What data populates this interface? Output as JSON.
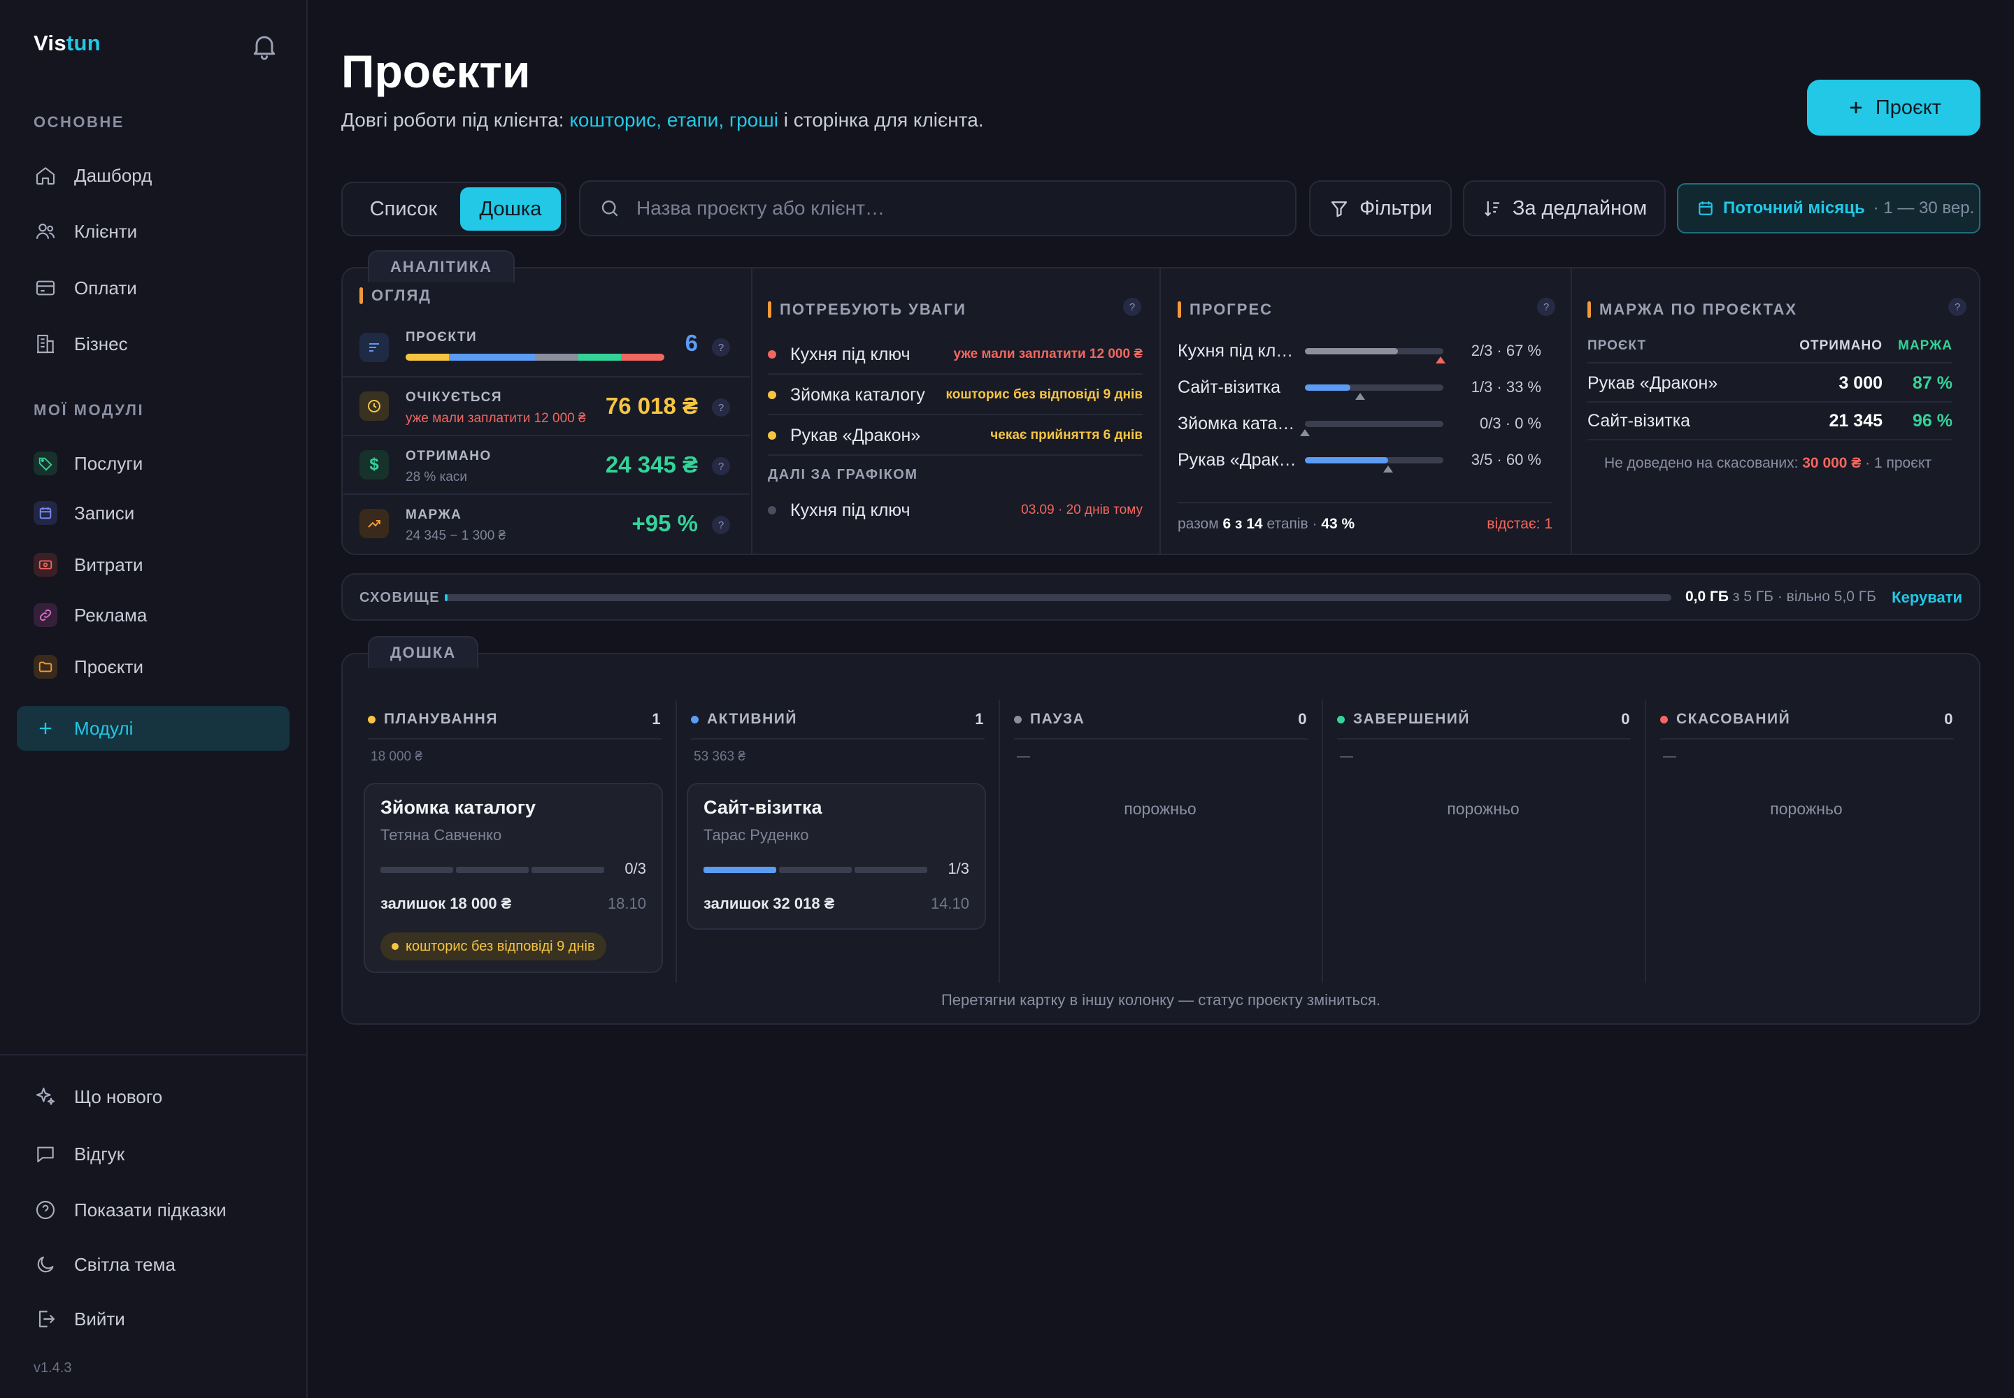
{
  "sidebar": {
    "logo_a": "Vis",
    "logo_b": "tun",
    "sec_main": "ОСНОВНЕ",
    "sec_modules": "МОЇ МОДУЛІ",
    "main_items": [
      "Дашборд",
      "Клієнти",
      "Оплати",
      "Бізнес"
    ],
    "module_items": [
      "Послуги",
      "Записи",
      "Витрати",
      "Реклама",
      "Проєкти"
    ],
    "modules_btn": "Модулі",
    "bottom_items": [
      "Що нового",
      "Відгук",
      "Показати підказки",
      "Світла тема",
      "Вийти"
    ],
    "version": "v1.4.3"
  },
  "header": {
    "title": "Проєкти",
    "sub_a": "Довгі роботи під клієнта: ",
    "sub_hl": "кошторис, етапи, гроші",
    "sub_b": " і сторінка для клієнта.",
    "new_btn": "Проєкт"
  },
  "toolbar": {
    "view_list": "Список",
    "view_board": "Дошка",
    "search_placeholder": "Назва проєкту або клієнт…",
    "filters": "Фільтри",
    "sort": "За дедлайном",
    "period": "Поточний місяць",
    "period_range": "· 1 — 30 вер."
  },
  "analytics": {
    "tag": "АНАЛІТИКА",
    "overview": {
      "title": "ОГЛЯД",
      "projects_label": "ПРОЄКТИ",
      "projects_val": "6",
      "expected_label": "ОЧІКУЄТЬСЯ",
      "expected_sub": "уже мали заплатити 12 000 ₴",
      "expected_val": "76 018 ₴",
      "received_label": "ОТРИМАНО",
      "received_sub": "28 % каси",
      "received_val": "24 345 ₴",
      "margin_label": "МАРЖА",
      "margin_sub": "24 345 − 1 300 ₴",
      "margin_val": "+95 %"
    },
    "attention": {
      "title": "ПОТРЕБУЮТЬ УВАГИ",
      "items": [
        {
          "name": "Кухня під ключ",
          "note": "уже мали заплатити 12 000 ₴",
          "color": "#f2675f"
        },
        {
          "name": "Зйомка каталогу",
          "note": "кошторис без відповіді 9 днів",
          "color": "#f5c542"
        },
        {
          "name": "Рукав «Дракон»",
          "note": "чекає прийняття 6 днів",
          "color": "#f5c542"
        }
      ],
      "next_title": "ДАЛІ ЗА ГРАФІКОМ",
      "next": {
        "name": "Кухня під ключ",
        "note": "03.09 · 20 днів тому"
      }
    },
    "progress": {
      "title": "ПРОГРЕС",
      "items": [
        {
          "name": "Кухня під ключ",
          "value": "2/3 · 67 %",
          "pct": 0.67,
          "color": "#8e909c",
          "mark": 0.98,
          "late": true
        },
        {
          "name": "Сайт-візитка",
          "value": "1/3 · 33 %",
          "pct": 0.33,
          "color": "#5b9cf5",
          "mark": 0.4,
          "late": false
        },
        {
          "name": "Зйомка каталогу",
          "value": "0/3 · 0 %",
          "pct": 0,
          "color": "#8e909c",
          "mark": 0,
          "late": false
        },
        {
          "name": "Рукав «Дракон»",
          "value": "3/5 · 60 %",
          "pct": 0.6,
          "color": "#5b9cf5",
          "mark": 0.6,
          "late": false
        }
      ],
      "total_a": "разом ",
      "total_b": "6 з 14",
      "total_c": " етапів · ",
      "total_d": "43 %",
      "behind": "відстає: 1"
    },
    "margin": {
      "title": "МАРЖА ПО ПРОЄКТАХ",
      "col_project": "ПРОЄКТ",
      "col_received": "ОТРИМАНО",
      "col_margin": "МАРЖА",
      "rows": [
        {
          "name": "Рукав «Дракон»",
          "received": "3 000",
          "margin": "87 %"
        },
        {
          "name": "Сайт-візитка",
          "received": "21 345",
          "margin": "96 %"
        }
      ],
      "note_a": "Не доведено на скасованих: ",
      "note_val": "30 000 ₴",
      "note_b": " · 1 проєкт"
    }
  },
  "storage": {
    "label": "СХОВИЩЕ",
    "used": "0,0 ГБ",
    "rest": " з 5 ГБ · вільно 5,0 ГБ",
    "manage": "Керувати",
    "fraction": 0.002
  },
  "board": {
    "tag": "ДОШКА",
    "columns": [
      {
        "title": "ПЛАНУВАННЯ",
        "count": "1",
        "sum": "18 000 ₴",
        "color": "#f5c542"
      },
      {
        "title": "АКТИВНИЙ",
        "count": "1",
        "sum": "53 363 ₴",
        "color": "#5b9cf5"
      },
      {
        "title": "ПАУЗА",
        "count": "0",
        "sum": "—",
        "color": "#8a8f9e"
      },
      {
        "title": "ЗАВЕРШЕНИЙ",
        "count": "0",
        "sum": "—",
        "color": "#34d399"
      },
      {
        "title": "СКАСОВАНИЙ",
        "count": "0",
        "sum": "—",
        "color": "#f2675f"
      }
    ],
    "empty": "порожньо",
    "cards": [
      {
        "title": "Зйомка каталогу",
        "client": "Тетяна Савченко",
        "stages": "0/3",
        "done": 0,
        "remaining": "залишок 18 000 ₴",
        "date": "18.10",
        "warning": "кошторис без відповіді 9 днів"
      },
      {
        "title": "Сайт-візитка",
        "client": "Тарас Руденко",
        "stages": "1/3",
        "done": 1,
        "remaining": "залишок 32 018 ₴",
        "date": "14.10"
      }
    ],
    "hint": "Перетягни картку в іншу колонку — статус проєкту зміниться."
  }
}
